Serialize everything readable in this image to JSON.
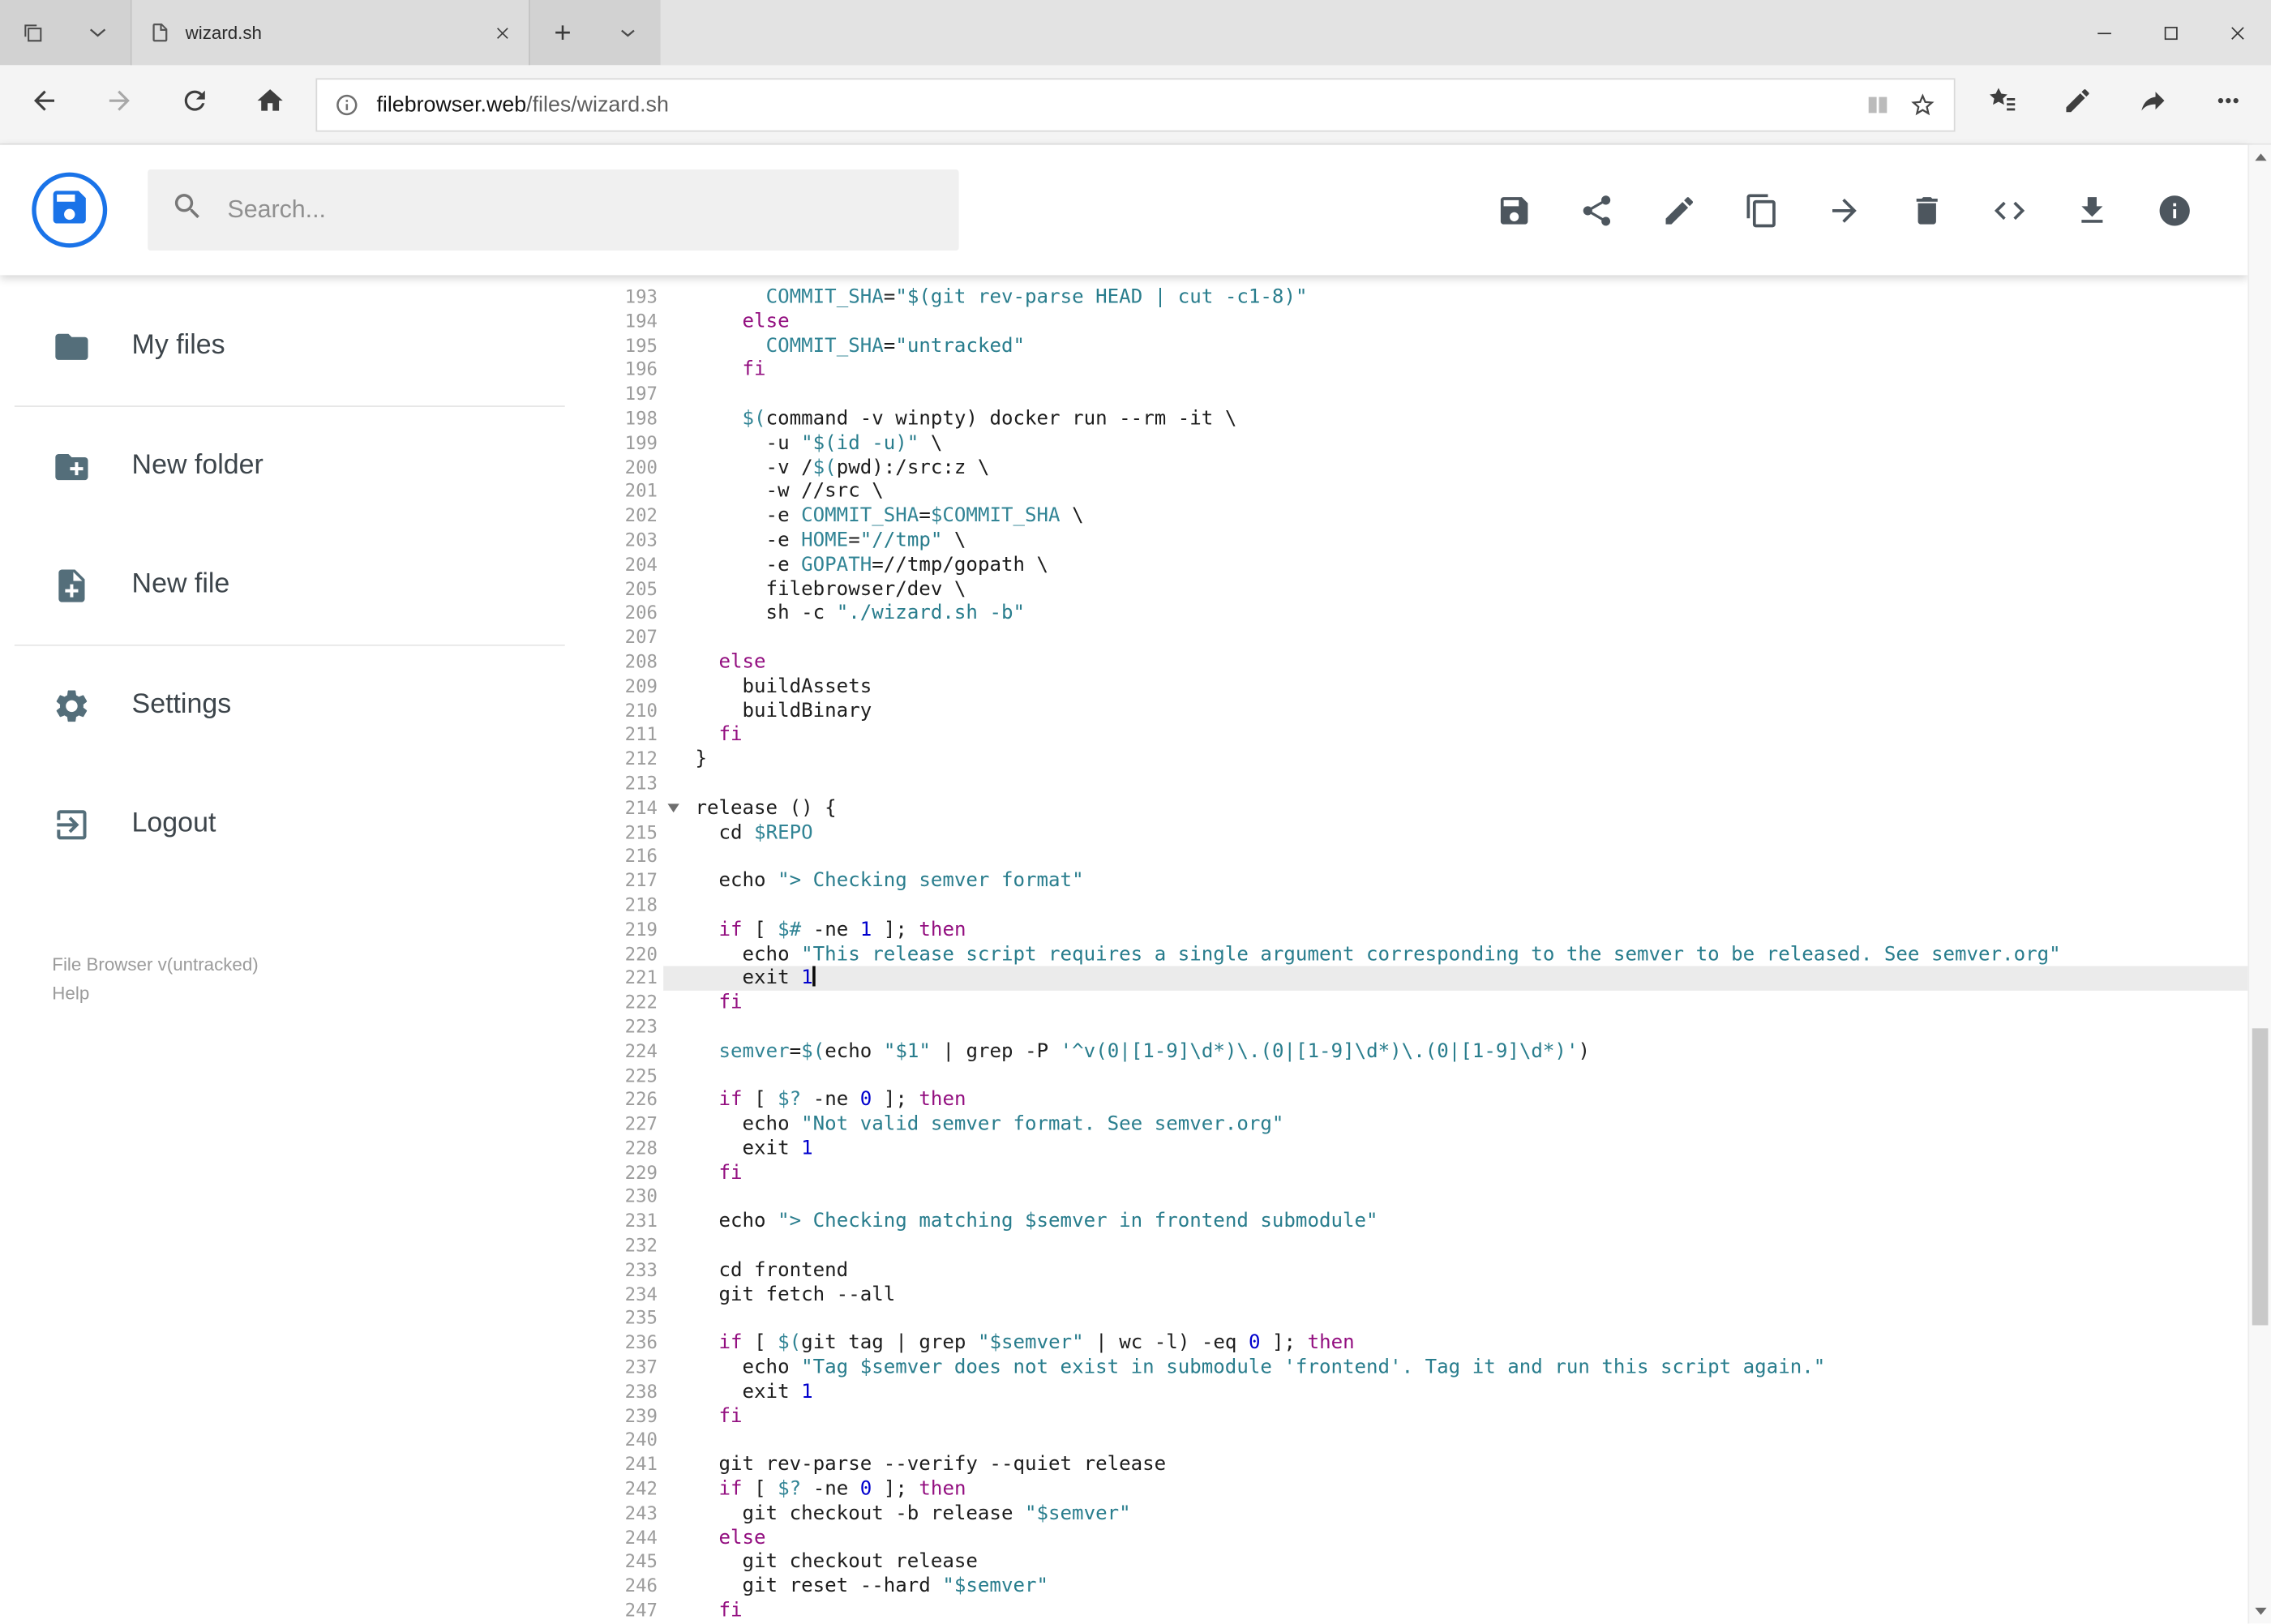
{
  "colors": {
    "accent_blue": "#1a73e8",
    "header_icon_gray": "#4d565e",
    "sidebar_icon_gray": "#546e7a",
    "syntax_keyword": "#930f80",
    "syntax_string": "#297d8d",
    "syntax_variable": "#318495",
    "syntax_number": "#0000cd",
    "active_line_bg": "#ebebeb"
  },
  "browser": {
    "tab": {
      "title": "wizard.sh"
    },
    "address": {
      "domain": "filebrowser.web",
      "path": "/files/wizard.sh"
    }
  },
  "app": {
    "header": {
      "search_placeholder": "Search...",
      "actions": [
        {
          "name": "save",
          "icon": "save"
        },
        {
          "name": "share",
          "icon": "share"
        },
        {
          "name": "rename",
          "icon": "edit"
        },
        {
          "name": "copy",
          "icon": "copy"
        },
        {
          "name": "move",
          "icon": "move"
        },
        {
          "name": "delete",
          "icon": "delete"
        },
        {
          "name": "raw-view",
          "icon": "code"
        },
        {
          "name": "download",
          "icon": "download"
        },
        {
          "name": "info",
          "icon": "info"
        }
      ]
    },
    "sidebar": {
      "items": [
        {
          "label": "My files",
          "icon": "folder",
          "divider_after": true
        },
        {
          "label": "New folder",
          "icon": "folder-plus",
          "divider_after": false
        },
        {
          "label": "New file",
          "icon": "file-plus",
          "divider_after": true
        },
        {
          "label": "Settings",
          "icon": "settings",
          "divider_after": false
        },
        {
          "label": "Logout",
          "icon": "logout",
          "divider_after": false
        }
      ],
      "footer_version": "File Browser v(untracked)",
      "footer_help": "Help"
    }
  },
  "editor": {
    "first_line": 193,
    "active_line": 221,
    "fold_lines": [
      214
    ],
    "lines": [
      "      COMMIT_SHA=\"$(git rev-parse HEAD | cut -c1-8)\"",
      "    else",
      "      COMMIT_SHA=\"untracked\"",
      "    fi",
      "",
      "    $(command -v winpty) docker run --rm -it \\",
      "      -u \"$(id -u)\" \\",
      "      -v /$(pwd):/src:z \\",
      "      -w //src \\",
      "      -e COMMIT_SHA=$COMMIT_SHA \\",
      "      -e HOME=\"//tmp\" \\",
      "      -e GOPATH=//tmp/gopath \\",
      "      filebrowser/dev \\",
      "      sh -c \"./wizard.sh -b\"",
      "",
      "  else",
      "    buildAssets",
      "    buildBinary",
      "  fi",
      "}",
      "",
      "release () {",
      "  cd $REPO",
      "",
      "  echo \"> Checking semver format\"",
      "",
      "  if [ $# -ne 1 ]; then",
      "    echo \"This release script requires a single argument corresponding to the semver to be released. See semver.org\"",
      "    exit 1",
      "  fi",
      "",
      "  semver=$(echo \"$1\" | grep -P '^v(0|[1-9]\\d*)\\.(0|[1-9]\\d*)\\.(0|[1-9]\\d*)')",
      "",
      "  if [ $? -ne 0 ]; then",
      "    echo \"Not valid semver format. See semver.org\"",
      "    exit 1",
      "  fi",
      "",
      "  echo \"> Checking matching $semver in frontend submodule\"",
      "",
      "  cd frontend",
      "  git fetch --all",
      "",
      "  if [ $(git tag | grep \"$semver\" | wc -l) -eq 0 ]; then",
      "    echo \"Tag $semver does not exist in submodule 'frontend'. Tag it and run this script again.\"",
      "    exit 1",
      "  fi",
      "",
      "  git rev-parse --verify --quiet release",
      "  if [ $? -ne 0 ]; then",
      "    git checkout -b release \"$semver\"",
      "  else",
      "    git checkout release",
      "    git reset --hard \"$semver\"",
      "  fi"
    ]
  }
}
